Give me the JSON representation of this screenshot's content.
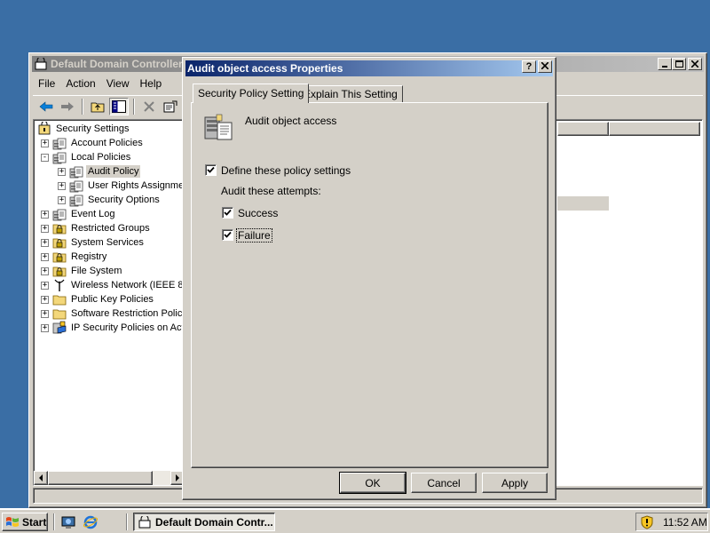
{
  "main_window": {
    "title": "Default Domain Controller",
    "menu": [
      "File",
      "Action",
      "View",
      "Help"
    ],
    "tree": [
      {
        "label": "Security Settings",
        "depth": 0,
        "expander": "",
        "icon": "security-icon"
      },
      {
        "label": "Account Policies",
        "depth": 1,
        "expander": "+",
        "icon": "policy-icon"
      },
      {
        "label": "Local Policies",
        "depth": 1,
        "expander": "-",
        "icon": "policy-icon"
      },
      {
        "label": "Audit Policy",
        "depth": 2,
        "expander": "+",
        "icon": "policy-icon",
        "selected": true
      },
      {
        "label": "User Rights Assignment",
        "depth": 2,
        "expander": "+",
        "icon": "policy-icon"
      },
      {
        "label": "Security Options",
        "depth": 2,
        "expander": "+",
        "icon": "policy-icon"
      },
      {
        "label": "Event Log",
        "depth": 1,
        "expander": "+",
        "icon": "policy-icon"
      },
      {
        "label": "Restricted Groups",
        "depth": 1,
        "expander": "+",
        "icon": "locked-folder-icon"
      },
      {
        "label": "System Services",
        "depth": 1,
        "expander": "+",
        "icon": "locked-folder-icon"
      },
      {
        "label": "Registry",
        "depth": 1,
        "expander": "+",
        "icon": "locked-folder-icon"
      },
      {
        "label": "File System",
        "depth": 1,
        "expander": "+",
        "icon": "locked-folder-icon"
      },
      {
        "label": "Wireless Network (IEEE 802.11)",
        "depth": 1,
        "expander": "+",
        "icon": "antenna-icon"
      },
      {
        "label": "Public Key Policies",
        "depth": 1,
        "expander": "+",
        "icon": "folder-icon"
      },
      {
        "label": "Software Restriction Policies",
        "depth": 1,
        "expander": "+",
        "icon": "folder-icon"
      },
      {
        "label": "IP Security Policies on Active Directory",
        "depth": 1,
        "expander": "+",
        "icon": "ip-security-icon"
      }
    ]
  },
  "dialog": {
    "title": "Audit object access Properties",
    "help_label": "?",
    "close_label": "X",
    "tabs": [
      "Security Policy Setting",
      "Explain This Setting"
    ],
    "policy_name": "Audit object access",
    "define_label": "Define these policy settings",
    "define_checked": true,
    "attempts_label": "Audit these attempts:",
    "success_label": "Success",
    "success_checked": true,
    "failure_label": "Failure",
    "failure_checked": true,
    "buttons": {
      "ok": "OK",
      "cancel": "Cancel",
      "apply": "Apply"
    }
  },
  "taskbar": {
    "start_label": "Start",
    "task_label": "Default Domain Contr...",
    "clock": "11:52 AM"
  },
  "colors": {
    "desktop": "#3a6ea5",
    "active_title": "#0a246a",
    "face": "#d4d0c8"
  }
}
